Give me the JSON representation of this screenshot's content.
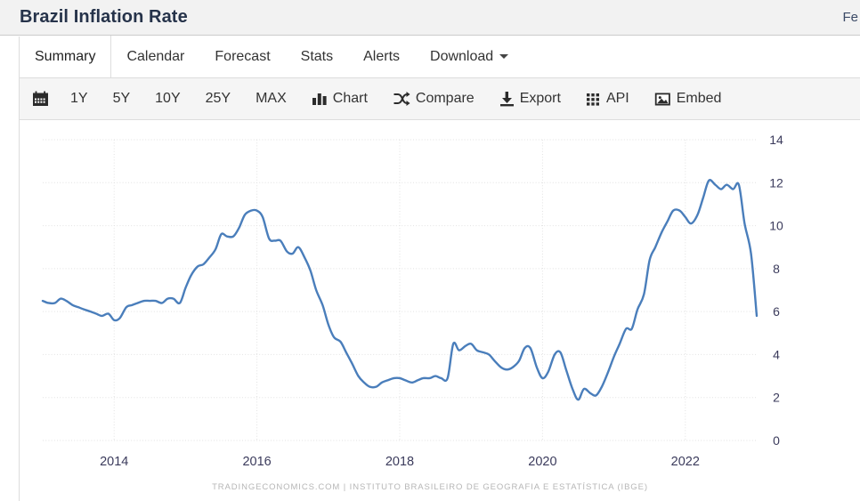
{
  "header": {
    "title": "Brazil Inflation Rate",
    "right_text": "Fe"
  },
  "tabs": [
    {
      "label": "Summary",
      "active": true
    },
    {
      "label": "Calendar",
      "active": false
    },
    {
      "label": "Forecast",
      "active": false
    },
    {
      "label": "Stats",
      "active": false
    },
    {
      "label": "Alerts",
      "active": false
    },
    {
      "label": "Download",
      "active": false,
      "caret": true
    }
  ],
  "toolbar": [
    {
      "label": "",
      "icon": "calendar-icon"
    },
    {
      "label": "1Y",
      "icon": ""
    },
    {
      "label": "5Y",
      "icon": ""
    },
    {
      "label": "10Y",
      "icon": ""
    },
    {
      "label": "25Y",
      "icon": ""
    },
    {
      "label": "MAX",
      "icon": ""
    },
    {
      "label": "Chart",
      "icon": "bar-chart-icon"
    },
    {
      "label": "Compare",
      "icon": "compare-icon"
    },
    {
      "label": "Export",
      "icon": "export-icon"
    },
    {
      "label": "API",
      "icon": "api-grid-icon"
    },
    {
      "label": "Embed",
      "icon": "embed-image-icon"
    }
  ],
  "footer": {
    "source": "TRADINGECONOMICS.COM  |  INSTITUTO BRASILEIRO DE GEOGRAFIA E ESTATÍSTICA (IBGE)"
  },
  "colors": {
    "line": "#4a7ebb",
    "grid": "#e2e2e2",
    "axis_text": "#3b3b5c",
    "header_bg": "#f2f2f2",
    "toolbar_bg": "#f5f5f5"
  },
  "chart_data": {
    "type": "line",
    "title": "Brazil Inflation Rate",
    "xlabel": "",
    "ylabel": "",
    "ylim": [
      0,
      14
    ],
    "yticks": [
      0,
      2,
      4,
      6,
      8,
      10,
      12,
      14
    ],
    "xlim": [
      2013.0,
      2023.0
    ],
    "xticks": [
      2014,
      2016,
      2018,
      2020,
      2022
    ],
    "xtick_labels": [
      "2014",
      "2016",
      "2018",
      "2020",
      "2022"
    ],
    "grid": true,
    "legend": "none",
    "series": [
      {
        "name": "Inflation Rate",
        "color": "#4a7ebb",
        "x": [
          2013.0,
          2013.08,
          2013.17,
          2013.25,
          2013.33,
          2013.42,
          2013.5,
          2013.58,
          2013.67,
          2013.75,
          2013.83,
          2013.92,
          2014.0,
          2014.08,
          2014.17,
          2014.25,
          2014.33,
          2014.42,
          2014.5,
          2014.58,
          2014.67,
          2014.75,
          2014.83,
          2014.92,
          2015.0,
          2015.08,
          2015.17,
          2015.25,
          2015.33,
          2015.42,
          2015.5,
          2015.58,
          2015.67,
          2015.75,
          2015.83,
          2015.92,
          2016.0,
          2016.08,
          2016.17,
          2016.25,
          2016.33,
          2016.42,
          2016.5,
          2016.58,
          2016.67,
          2016.75,
          2016.83,
          2016.92,
          2017.0,
          2017.08,
          2017.17,
          2017.25,
          2017.33,
          2017.42,
          2017.5,
          2017.58,
          2017.67,
          2017.75,
          2017.83,
          2017.92,
          2018.0,
          2018.08,
          2018.17,
          2018.25,
          2018.33,
          2018.42,
          2018.5,
          2018.58,
          2018.67,
          2018.75,
          2018.83,
          2018.92,
          2019.0,
          2019.08,
          2019.17,
          2019.25,
          2019.33,
          2019.42,
          2019.5,
          2019.58,
          2019.67,
          2019.75,
          2019.83,
          2019.92,
          2020.0,
          2020.08,
          2020.17,
          2020.25,
          2020.33,
          2020.42,
          2020.5,
          2020.58,
          2020.67,
          2020.75,
          2020.83,
          2020.92,
          2021.0,
          2021.08,
          2021.17,
          2021.25,
          2021.33,
          2021.42,
          2021.5,
          2021.58,
          2021.67,
          2021.75,
          2021.83,
          2021.92,
          2022.0,
          2022.08,
          2022.17,
          2022.25,
          2022.33,
          2022.42,
          2022.5,
          2022.58,
          2022.67,
          2022.75,
          2022.83,
          2022.92,
          2023.0
        ],
        "y": [
          6.5,
          6.4,
          6.4,
          6.6,
          6.5,
          6.3,
          6.2,
          6.1,
          6.0,
          5.9,
          5.8,
          5.9,
          5.6,
          5.7,
          6.2,
          6.3,
          6.4,
          6.5,
          6.5,
          6.5,
          6.4,
          6.6,
          6.6,
          6.4,
          7.1,
          7.7,
          8.1,
          8.2,
          8.5,
          8.9,
          9.6,
          9.5,
          9.5,
          9.9,
          10.5,
          10.7,
          10.7,
          10.4,
          9.4,
          9.3,
          9.3,
          8.8,
          8.7,
          9.0,
          8.5,
          7.9,
          7.0,
          6.3,
          5.4,
          4.8,
          4.6,
          4.1,
          3.6,
          3.0,
          2.7,
          2.5,
          2.5,
          2.7,
          2.8,
          2.9,
          2.9,
          2.8,
          2.7,
          2.8,
          2.9,
          2.9,
          3.0,
          2.9,
          2.9,
          4.5,
          4.2,
          4.4,
          4.5,
          4.2,
          4.1,
          4.0,
          3.7,
          3.4,
          3.3,
          3.4,
          3.7,
          4.3,
          4.3,
          3.4,
          2.9,
          3.2,
          4.0,
          4.1,
          3.3,
          2.4,
          1.9,
          2.4,
          2.2,
          2.1,
          2.5,
          3.2,
          3.9,
          4.5,
          5.2,
          5.2,
          6.1,
          6.8,
          8.4,
          9.0,
          9.7,
          10.2,
          10.7,
          10.7,
          10.4,
          10.1,
          10.5,
          11.3,
          12.1,
          11.9,
          11.7,
          11.9,
          11.7,
          11.9,
          10.1,
          8.7,
          5.8
        ]
      }
    ],
    "last_value": 5.8,
    "peak_2016": 10.7,
    "peak_2022": 12.1,
    "trough_2017": 2.5,
    "trough_2020": 1.9
  }
}
